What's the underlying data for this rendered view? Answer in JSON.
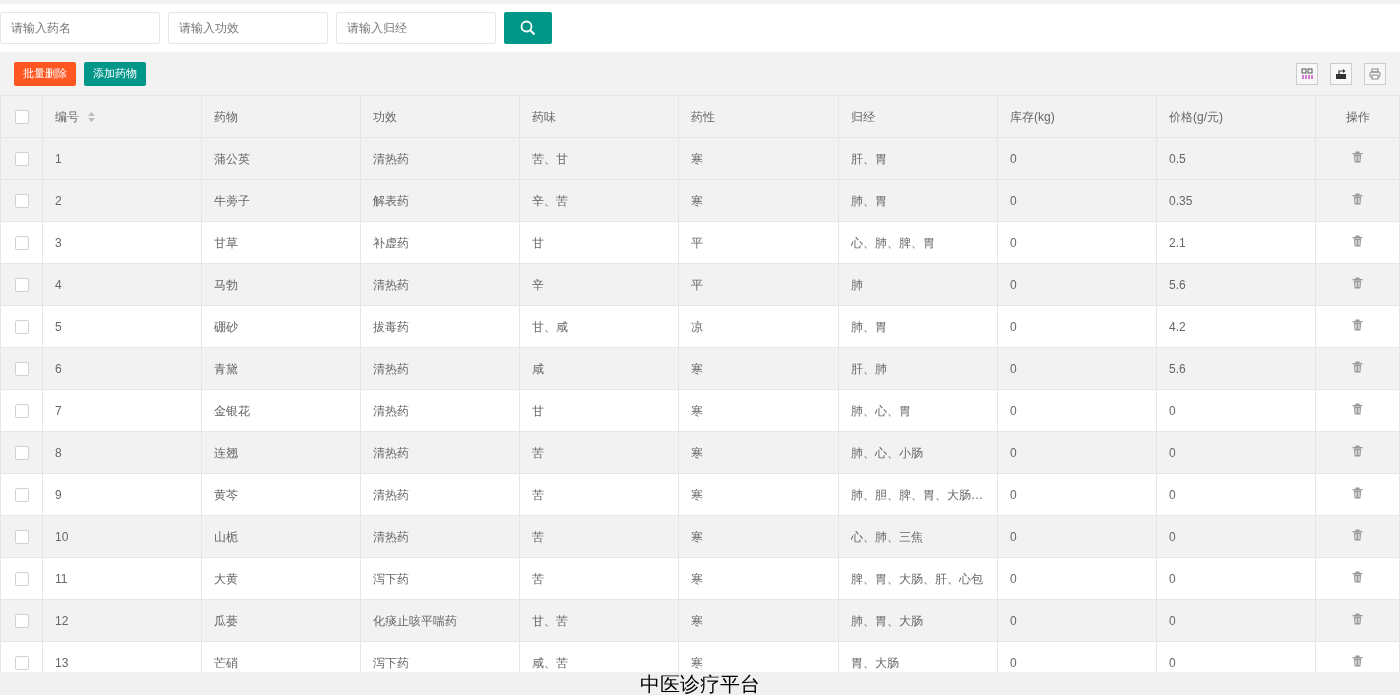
{
  "search": {
    "fields": [
      {
        "placeholder": "请输入药名"
      },
      {
        "placeholder": "请输入功效"
      },
      {
        "placeholder": "请输入归经"
      }
    ]
  },
  "toolbar": {
    "buttons": [
      {
        "label": "批量删除",
        "kind": "danger"
      },
      {
        "label": "添加药物",
        "kind": "primary"
      }
    ]
  },
  "table": {
    "all_checked": false,
    "columns": [
      {
        "label": "编号",
        "sortable": true
      },
      {
        "label": "药物",
        "sortable": false
      },
      {
        "label": "功效",
        "sortable": false
      },
      {
        "label": "药味",
        "sortable": false
      },
      {
        "label": "药性",
        "sortable": false
      },
      {
        "label": "归经",
        "sortable": false
      },
      {
        "label": "库存(kg)",
        "sortable": false
      },
      {
        "label": "价格(g/元)",
        "sortable": false
      },
      {
        "label": "操作",
        "sortable": false
      }
    ],
    "rows": [
      {
        "checked": false,
        "highlighted": true,
        "cells": [
          "1",
          "蒲公英",
          "清热药",
          "苦、甘",
          "寒",
          "肝、胃",
          "0",
          "0.5"
        ]
      },
      {
        "checked": false,
        "highlighted": true,
        "cells": [
          "2",
          "牛蒡子",
          "解表药",
          "辛、苦",
          "寒",
          "肺、胃",
          "0",
          "0.35"
        ]
      },
      {
        "checked": false,
        "highlighted": false,
        "cells": [
          "3",
          "甘草",
          "补虚药",
          "甘",
          "平",
          "心、肺、脾、胃",
          "0",
          "2.1"
        ]
      },
      {
        "checked": false,
        "highlighted": true,
        "cells": [
          "4",
          "马勃",
          "清热药",
          "辛",
          "平",
          "肺",
          "0",
          "5.6"
        ]
      },
      {
        "checked": false,
        "highlighted": false,
        "cells": [
          "5",
          "硼砂",
          "拔毒药",
          "甘、咸",
          "凉",
          "肺、胃",
          "0",
          "4.2"
        ]
      },
      {
        "checked": false,
        "highlighted": true,
        "cells": [
          "6",
          "青黛",
          "清热药",
          "咸",
          "寒",
          "肝、肺",
          "0",
          "5.6"
        ]
      },
      {
        "checked": false,
        "highlighted": false,
        "cells": [
          "7",
          "金银花",
          "清热药",
          "甘",
          "寒",
          "肺、心、胃",
          "0",
          "0"
        ]
      },
      {
        "checked": false,
        "highlighted": true,
        "cells": [
          "8",
          "连翘",
          "清热药",
          "苦",
          "寒",
          "肺、心、小肠",
          "0",
          "0"
        ]
      },
      {
        "checked": false,
        "highlighted": false,
        "cells": [
          "9",
          "黄芩",
          "清热药",
          "苦",
          "寒",
          "肺、胆、脾、胃、大肠…",
          "0",
          "0"
        ]
      },
      {
        "checked": false,
        "highlighted": true,
        "cells": [
          "10",
          "山栀",
          "清热药",
          "苦",
          "寒",
          "心、肺、三焦",
          "0",
          "0"
        ]
      },
      {
        "checked": false,
        "highlighted": false,
        "cells": [
          "11",
          "大黄",
          "泻下药",
          "苦",
          "寒",
          "脾、胃、大肠、肝、心包",
          "0",
          "0"
        ]
      },
      {
        "checked": false,
        "highlighted": true,
        "cells": [
          "12",
          "瓜蒌",
          "化痰止咳平喘药",
          "甘、苦",
          "寒",
          "肺、胃、大肠",
          "0",
          "0"
        ]
      },
      {
        "checked": false,
        "highlighted": false,
        "cells": [
          "13",
          "芒硝",
          "泻下药",
          "咸、苦",
          "寒",
          "胃、大肠",
          "0",
          "0"
        ]
      }
    ]
  },
  "footer": {
    "text": "中医诊疗平台"
  }
}
